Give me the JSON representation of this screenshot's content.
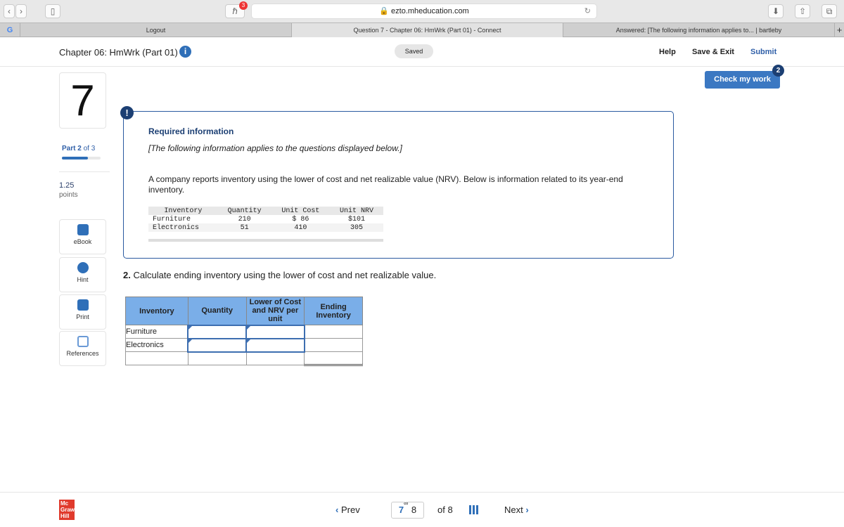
{
  "browser": {
    "url": "ezto.mheducation.com",
    "badge": "3",
    "tabs": [
      "Logout",
      "Question 7 - Chapter 06: HmWrk (Part 01) - Connect",
      "Answered: [The following information applies to... | bartleby"
    ],
    "new_tab": "+"
  },
  "header": {
    "title": "Chapter 06: HmWrk (Part 01)",
    "saved": "Saved",
    "help": "Help",
    "save_exit": "Save & Exit",
    "submit": "Submit",
    "check": "Check my work",
    "check_badge": "2"
  },
  "sidebar": {
    "question_number": "7",
    "part_label": "Part",
    "part_current": "2",
    "part_of": "of 3",
    "progress": 0.67,
    "points_value": "1.25",
    "points_label": "points",
    "tools": [
      "eBook",
      "Hint",
      "Print",
      "References"
    ]
  },
  "info": {
    "heading": "Required information",
    "subtitle": "[The following information applies to the questions displayed below.]",
    "body": "A company reports inventory using the lower of cost and net realizable value (NRV). Below is information related to its year-end inventory.",
    "table": {
      "headers": [
        "Inventory",
        "Quantity",
        "Unit Cost",
        "Unit NRV"
      ],
      "rows": [
        [
          "Furniture",
          "210",
          "$ 86",
          "$101"
        ],
        [
          "Electronics",
          "51",
          "410",
          "305"
        ]
      ]
    }
  },
  "question": {
    "number": "2.",
    "text": "Calculate ending inventory using the lower of cost and net realizable value.",
    "headers": [
      "Inventory",
      "Quantity",
      "Lower of Cost and NRV per unit",
      "Ending Inventory"
    ],
    "rows": [
      "Furniture",
      "Electronics"
    ]
  },
  "footer": {
    "logo": [
      "Mc",
      "Graw",
      "Hill"
    ],
    "prev": "Prev",
    "current": "7",
    "next_num": "8",
    "of": "of 8",
    "next": "Next"
  }
}
